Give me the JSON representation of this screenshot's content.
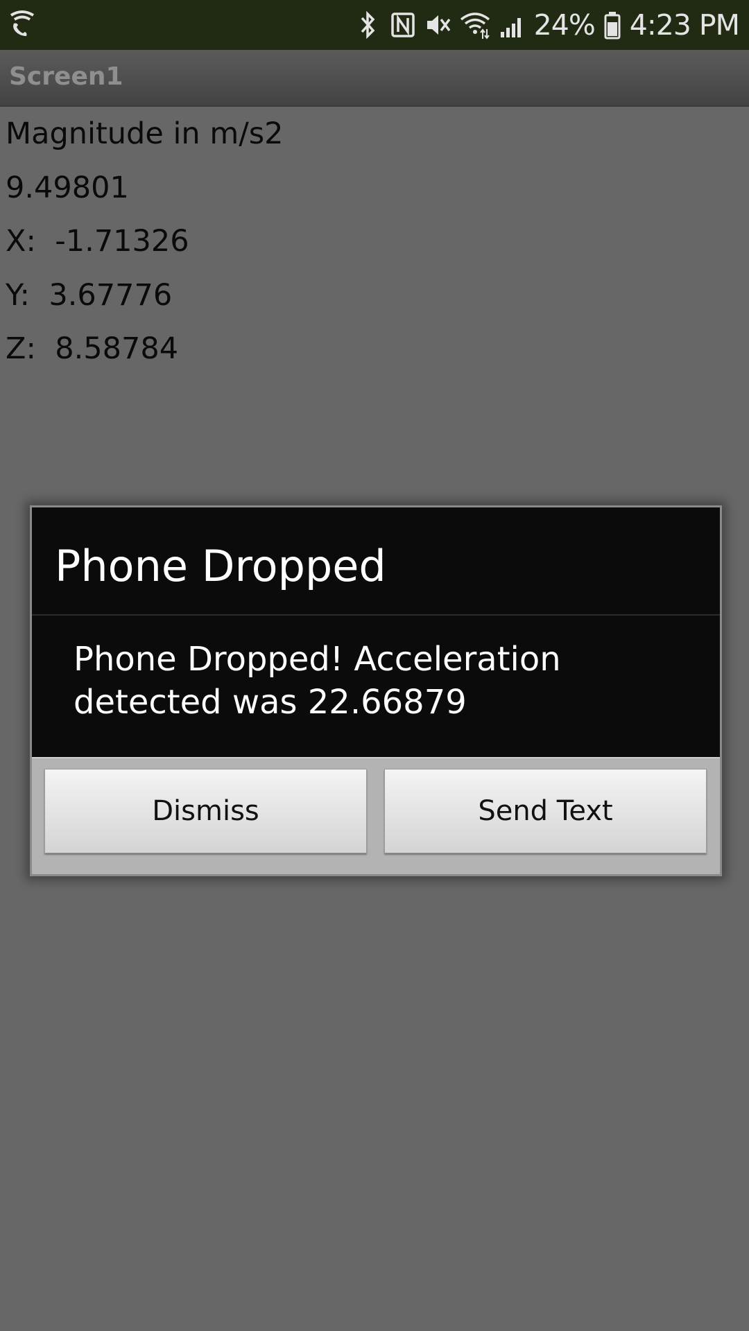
{
  "status_bar": {
    "icons": [
      "wifi-calling-icon",
      "bluetooth-icon",
      "nfc-icon",
      "vibrate-mute-icon",
      "wifi-icon",
      "cell-signal-icon",
      "battery-icon"
    ],
    "battery_percent": "24%",
    "time": "4:23 PM",
    "background_color": "#212a13"
  },
  "title_bar": {
    "title": "Screen1"
  },
  "content": {
    "magnitude_label": "Magnitude in m/s2",
    "magnitude_value": "9.49801",
    "x_line": "X:  -1.71326",
    "y_line": "Y:  3.67776",
    "z_line": "Z:  8.58784"
  },
  "dialog": {
    "title": "Phone Dropped",
    "message": "Phone Dropped! Acceleration detected was 22.66879",
    "buttons": {
      "dismiss": "Dismiss",
      "send_text": "Send Text"
    }
  },
  "colors": {
    "background": "#676767",
    "dialog_background": "#0b0b0b"
  }
}
